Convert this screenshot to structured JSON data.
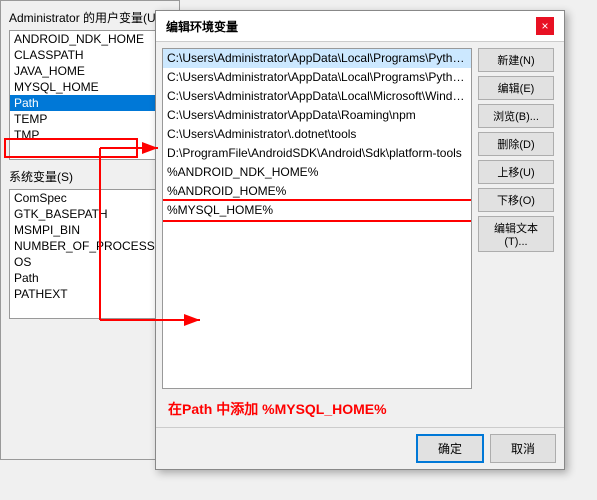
{
  "leftPanel": {
    "userVarsTitle": "Administrator 的用户变量(U)",
    "userVars": [
      {
        "name": "ANDROID_NDK_HOME",
        "selected": false
      },
      {
        "name": "CLASSPATH",
        "selected": false
      },
      {
        "name": "JAVA_HOME",
        "selected": false
      },
      {
        "name": "MYSQL_HOME",
        "selected": false
      },
      {
        "name": "Path",
        "selected": true,
        "highlighted": true
      },
      {
        "name": "TEMP",
        "selected": false
      },
      {
        "name": "TMP",
        "selected": false
      }
    ],
    "systemVarsTitle": "系统变量(S)",
    "systemVars": [
      {
        "name": "ComSpec",
        "selected": false
      },
      {
        "name": "GTK_BASEPATH",
        "selected": false
      },
      {
        "name": "MSMPI_BIN",
        "selected": false
      },
      {
        "name": "NUMBER_OF_PROCESSORS",
        "selected": false
      },
      {
        "name": "OS",
        "selected": false
      },
      {
        "name": "Path",
        "selected": false
      },
      {
        "name": "PATHEXT",
        "selected": false
      }
    ]
  },
  "dialog": {
    "title": "编辑环境变量",
    "closeLabel": "×",
    "paths": [
      {
        "value": "C:\\Users\\Administrator\\AppData\\Local\\Programs\\Python\\Pytho...",
        "state": "first"
      },
      {
        "value": "C:\\Users\\Administrator\\AppData\\Local\\Programs\\Python\\Pytho...",
        "state": "normal"
      },
      {
        "value": "C:\\Users\\Administrator\\AppData\\Local\\Microsoft\\WindowsApps",
        "state": "normal"
      },
      {
        "value": "C:\\Users\\Administrator\\AppData\\Roaming\\npm",
        "state": "normal"
      },
      {
        "value": "C:\\Users\\Administrator\\.dotnet\\tools",
        "state": "normal"
      },
      {
        "value": "D:\\ProgramFile\\AndroidSDK\\Android\\Sdk\\platform-tools",
        "state": "normal"
      },
      {
        "value": "%ANDROID_NDK_HOME%",
        "state": "normal"
      },
      {
        "value": "%ANDROID_HOME%",
        "state": "normal"
      },
      {
        "value": "%MYSQL_HOME%",
        "state": "highlighted"
      }
    ],
    "buttons": [
      {
        "label": "新建(N)"
      },
      {
        "label": "编辑(E)"
      },
      {
        "label": "浏览(B)..."
      },
      {
        "label": "删除(D)"
      },
      {
        "label": "上移(U)"
      },
      {
        "label": "下移(O)"
      },
      {
        "label": "编辑文本(T)..."
      }
    ],
    "footerButtons": [
      {
        "label": "确定",
        "primary": true
      },
      {
        "label": "取消",
        "primary": false
      }
    ]
  },
  "annotation": {
    "text": "在Path 中添加 %MYSQL_HOME%"
  }
}
